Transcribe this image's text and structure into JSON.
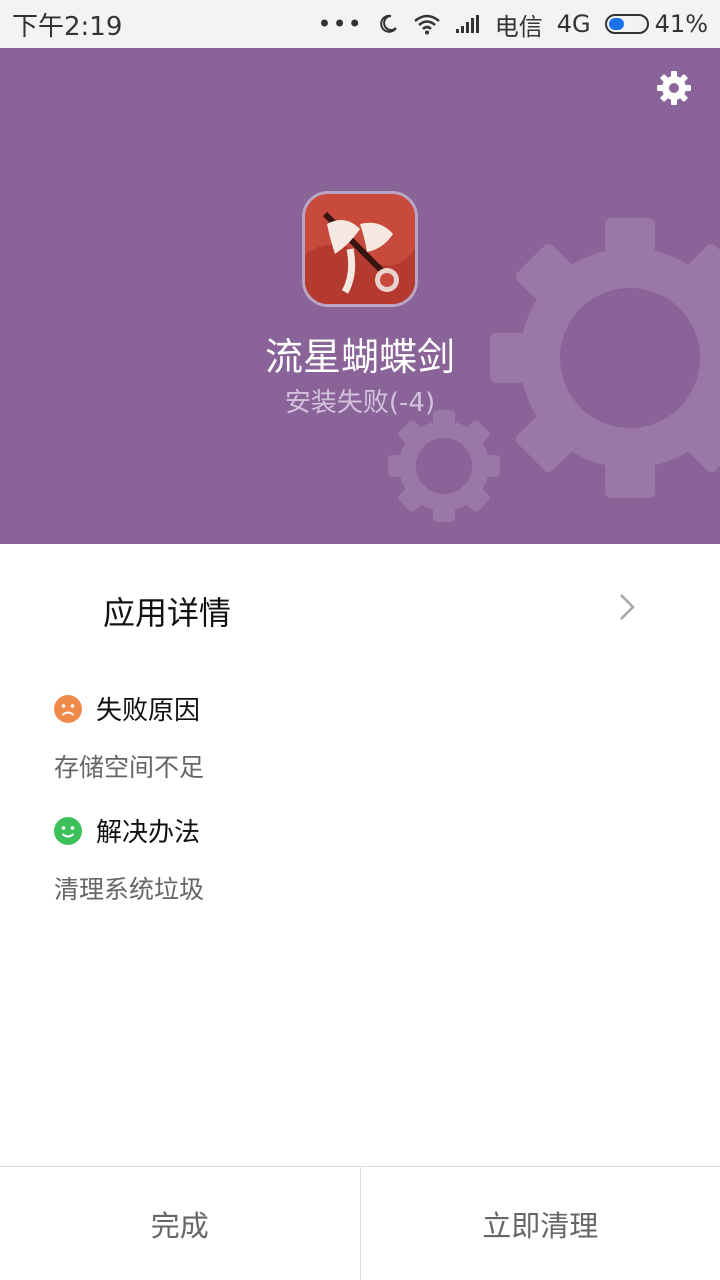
{
  "status_bar": {
    "time": "下午2:19",
    "dots": "•••",
    "carrier": "电信",
    "network": "4G",
    "battery": "41%",
    "battery_level": 0.41
  },
  "header": {
    "app_name": "流星蝴蝶剑",
    "install_status": "安装失败(-4)",
    "settings_icon": "gear-icon",
    "background_color": "#8a6398"
  },
  "detail": {
    "label": "应用详情"
  },
  "failure": {
    "title": "失败原因",
    "text": "存储空间不足",
    "icon": "sad-face-icon",
    "icon_color": "#f08a4b"
  },
  "solution": {
    "title": "解决办法",
    "text": "清理系统垃圾",
    "icon": "smile-face-icon",
    "icon_color": "#3cc15a"
  },
  "buttons": {
    "done": "完成",
    "clean_now": "立即清理"
  }
}
